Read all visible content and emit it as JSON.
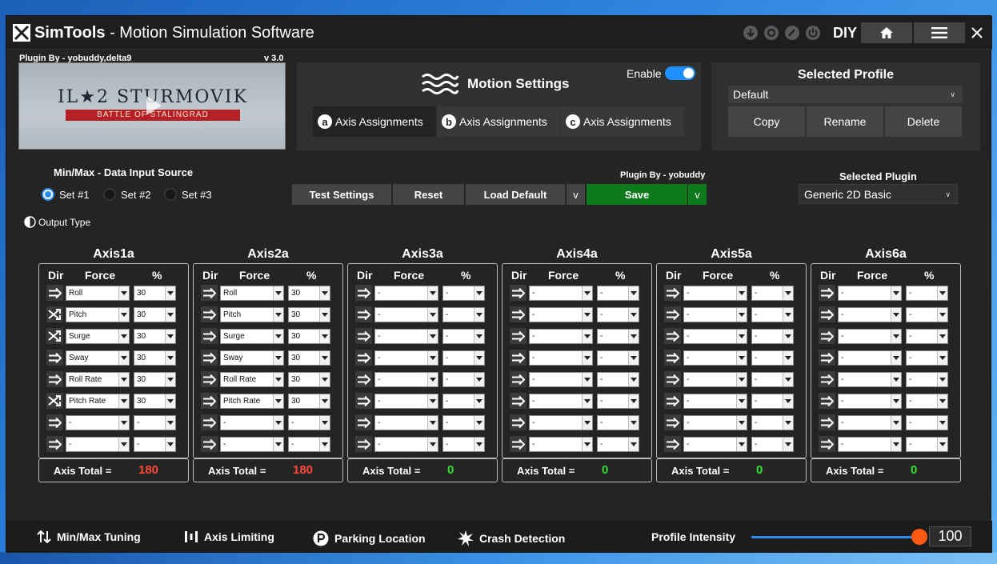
{
  "window": {
    "title_brand": "SimTools",
    "title_rest": " - Motion Simulation Software",
    "mode_label": "DIY"
  },
  "video": {
    "plugin_by": "Plugin By - yobuddy,delta9",
    "version": "v 3.0",
    "game_title": "IL★2 STURMOVIK",
    "game_subtitle": "BATTLE OF STALINGRAD"
  },
  "motion": {
    "title": "Motion Settings",
    "enable_label": "Enable",
    "enabled": true,
    "tabs": [
      {
        "letter": "a",
        "label": "Axis Assignments"
      },
      {
        "letter": "b",
        "label": "Axis Assignments"
      },
      {
        "letter": "c",
        "label": "Axis Assignments"
      }
    ]
  },
  "profile": {
    "title": "Selected Profile",
    "selected": "Default",
    "buttons": [
      "Copy",
      "Rename",
      "Delete"
    ]
  },
  "input_source": {
    "label": "Min/Max - Data Input Source",
    "options": [
      "Set #1",
      "Set #2",
      "Set #3"
    ],
    "selected_index": 0
  },
  "output_type_label": "Output Type",
  "actions": {
    "plugin_by": "Plugin By - yobuddy",
    "test": "Test Settings",
    "reset": "Reset",
    "load_default": "Load Default",
    "dropdown": "v",
    "save": "Save"
  },
  "plugin": {
    "label": "Selected Plugin",
    "selected": "Generic 2D Basic"
  },
  "axis_headers": {
    "dir": "Dir",
    "force": "Force",
    "pct": "%"
  },
  "axis_total_label": "Axis Total =",
  "axes": [
    {
      "name": "Axis1a",
      "total": "180",
      "total_color": "#ff4a3a",
      "rows": [
        {
          "dir": "normal",
          "force": "Roll",
          "pct": "30"
        },
        {
          "dir": "inverted",
          "force": "Pitch",
          "pct": "30"
        },
        {
          "dir": "inverted",
          "force": "Surge",
          "pct": "30"
        },
        {
          "dir": "normal",
          "force": "Sway",
          "pct": "30"
        },
        {
          "dir": "normal",
          "force": "Roll Rate",
          "pct": "30"
        },
        {
          "dir": "inverted",
          "force": "Pitch Rate",
          "pct": "30"
        },
        {
          "dir": "normal",
          "force": "-",
          "pct": "-"
        },
        {
          "dir": "normal",
          "force": "-",
          "pct": "-"
        }
      ]
    },
    {
      "name": "Axis2a",
      "total": "180",
      "total_color": "#ff4a3a",
      "rows": [
        {
          "dir": "normal",
          "force": "Roll",
          "pct": "30"
        },
        {
          "dir": "normal",
          "force": "Pitch",
          "pct": "30"
        },
        {
          "dir": "normal",
          "force": "Surge",
          "pct": "30"
        },
        {
          "dir": "normal",
          "force": "Sway",
          "pct": "30"
        },
        {
          "dir": "normal",
          "force": "Roll Rate",
          "pct": "30"
        },
        {
          "dir": "normal",
          "force": "Pitch Rate",
          "pct": "30"
        },
        {
          "dir": "normal",
          "force": "-",
          "pct": "-"
        },
        {
          "dir": "normal",
          "force": "-",
          "pct": "-"
        }
      ]
    },
    {
      "name": "Axis3a",
      "total": "0",
      "total_color": "#35e035",
      "rows": [
        {
          "dir": "normal",
          "force": "-",
          "pct": "-"
        },
        {
          "dir": "normal",
          "force": "-",
          "pct": "-"
        },
        {
          "dir": "normal",
          "force": "-",
          "pct": "-"
        },
        {
          "dir": "normal",
          "force": "-",
          "pct": "-"
        },
        {
          "dir": "normal",
          "force": "-",
          "pct": "-"
        },
        {
          "dir": "normal",
          "force": "-",
          "pct": "-"
        },
        {
          "dir": "normal",
          "force": "-",
          "pct": "-"
        },
        {
          "dir": "normal",
          "force": "-",
          "pct": "-"
        }
      ]
    },
    {
      "name": "Axis4a",
      "total": "0",
      "total_color": "#35e035",
      "rows": [
        {
          "dir": "normal",
          "force": "-",
          "pct": "-"
        },
        {
          "dir": "normal",
          "force": "-",
          "pct": "-"
        },
        {
          "dir": "normal",
          "force": "-",
          "pct": "-"
        },
        {
          "dir": "normal",
          "force": "-",
          "pct": "-"
        },
        {
          "dir": "normal",
          "force": "-",
          "pct": "-"
        },
        {
          "dir": "normal",
          "force": "-",
          "pct": "-"
        },
        {
          "dir": "normal",
          "force": "-",
          "pct": "-"
        },
        {
          "dir": "normal",
          "force": "-",
          "pct": "-"
        }
      ]
    },
    {
      "name": "Axis5a",
      "total": "0",
      "total_color": "#35e035",
      "rows": [
        {
          "dir": "normal",
          "force": "-",
          "pct": "-"
        },
        {
          "dir": "normal",
          "force": "-",
          "pct": "-"
        },
        {
          "dir": "normal",
          "force": "-",
          "pct": "-"
        },
        {
          "dir": "normal",
          "force": "-",
          "pct": "-"
        },
        {
          "dir": "normal",
          "force": "-",
          "pct": "-"
        },
        {
          "dir": "normal",
          "force": "-",
          "pct": "-"
        },
        {
          "dir": "normal",
          "force": "-",
          "pct": "-"
        },
        {
          "dir": "normal",
          "force": "-",
          "pct": "-"
        }
      ]
    },
    {
      "name": "Axis6a",
      "total": "0",
      "total_color": "#35e035",
      "rows": [
        {
          "dir": "normal",
          "force": "-",
          "pct": "-"
        },
        {
          "dir": "normal",
          "force": "-",
          "pct": "-"
        },
        {
          "dir": "normal",
          "force": "-",
          "pct": "-"
        },
        {
          "dir": "normal",
          "force": "-",
          "pct": "-"
        },
        {
          "dir": "normal",
          "force": "-",
          "pct": "-"
        },
        {
          "dir": "normal",
          "force": "-",
          "pct": "-"
        },
        {
          "dir": "normal",
          "force": "-",
          "pct": "-"
        },
        {
          "dir": "normal",
          "force": "-",
          "pct": "-"
        }
      ]
    }
  ],
  "bottom": {
    "minmax": "Min/Max Tuning",
    "axis_limiting": "Axis Limiting",
    "parking": "Parking Location",
    "crash": "Crash Detection",
    "intensity_label": "Profile Intensity",
    "intensity_value": "100",
    "intensity_fraction": 1.0
  },
  "colors": {
    "accent": "#2b8cf0",
    "save_green": "#0f7a1c",
    "slider_knob": "#ff5a12"
  }
}
